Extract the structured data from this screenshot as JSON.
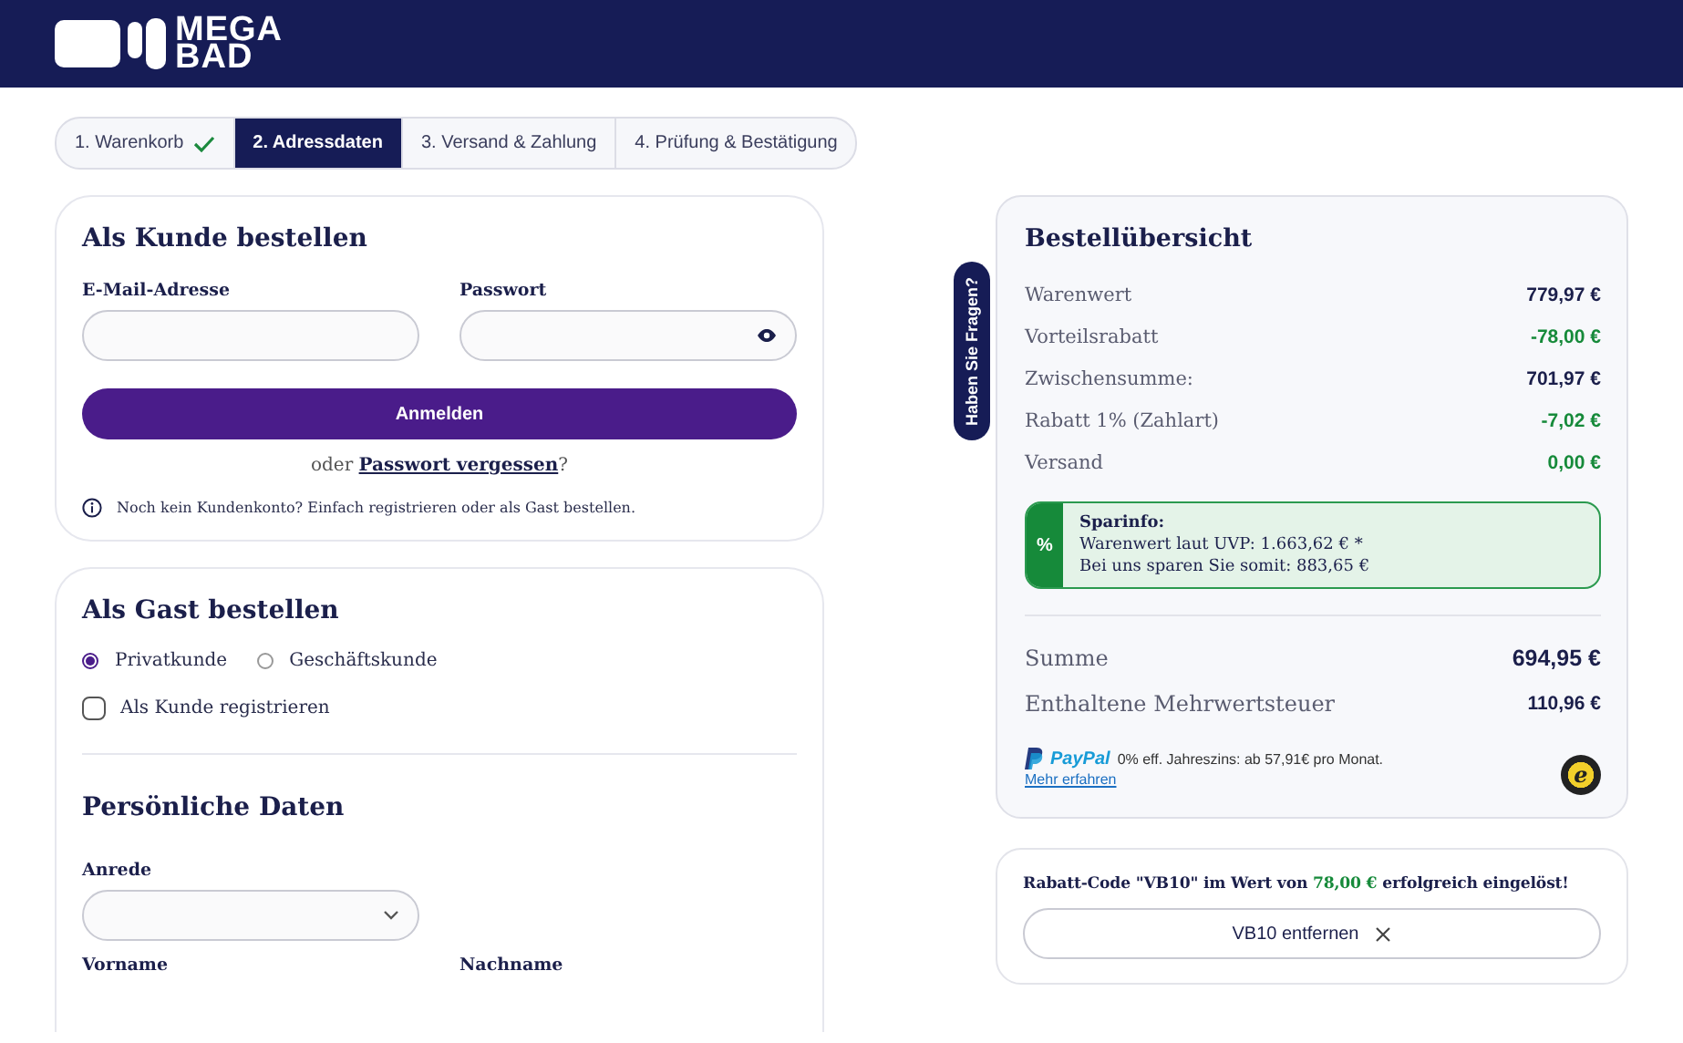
{
  "header": {
    "logo_lines": [
      "MEGA",
      "BAD"
    ]
  },
  "steps": [
    {
      "label": "1. Warenkorb",
      "selected": false,
      "done": true
    },
    {
      "label": "2. Adressdaten",
      "selected": true,
      "done": false
    },
    {
      "label": "3. Versand & Zahlung",
      "selected": false,
      "done": false
    },
    {
      "label": "4. Prüfung & Bestätigung",
      "selected": false,
      "done": false
    }
  ],
  "login": {
    "title": "Als Kunde bestellen",
    "email_label": "E-Mail-Adresse",
    "password_label": "Passwort",
    "submit": "Anmelden",
    "forgot_prefix": "oder",
    "forgot_link": "Passwort vergessen",
    "forgot_suffix": "?",
    "info": "Noch kein Kundenkonto? Einfach registrieren oder als Gast bestellen."
  },
  "guest": {
    "title": "Als Gast bestellen",
    "customer_types": [
      {
        "label": "Privatkunde",
        "selected": true
      },
      {
        "label": "Geschäftskunde",
        "selected": false
      }
    ],
    "register": {
      "label": "Als Kunde registrieren",
      "checked": false
    },
    "personal_title": "Persönliche Daten",
    "salutation_label": "Anrede",
    "first_name_label": "Vorname",
    "last_name_label": "Nachname"
  },
  "help_tab": "Haben Sie Fragen?",
  "summary": {
    "title": "Bestellübersicht",
    "rows": [
      {
        "label": "Warenwert",
        "value": "779,97 €",
        "kind": "normal"
      },
      {
        "label": "Vorteilsrabatt",
        "value": "-78,00 €",
        "kind": "saving"
      },
      {
        "label": "Zwischensumme:",
        "value": "701,97 €",
        "kind": "normal"
      },
      {
        "label": "Rabatt 1% (Zahlart)",
        "value": "-7,02 €",
        "kind": "saving"
      },
      {
        "label": "Versand",
        "value": "0,00 €",
        "kind": "saving"
      }
    ],
    "savings": {
      "badge": "%",
      "title": "Sparinfo:",
      "lines": [
        "Warenwert laut UVP: 1.663,62 € *",
        "Bei uns sparen Sie somit: 883,65 €"
      ]
    },
    "totals": [
      {
        "label": "Summe",
        "value": "694,95 €",
        "kind": "total"
      },
      {
        "label": "Enthaltene Mehrwertsteuer",
        "value": "110,96 €",
        "kind": "normal"
      }
    ],
    "paypal": {
      "brand": "PayPal",
      "text": "0% eff. Jahreszins: ab 57,91€ pro Monat.",
      "link": "Mehr erfahren"
    },
    "trust_badge": "e"
  },
  "voucher": {
    "prefix": "Rabatt-Code \"VB10\" im Wert von ",
    "amount": "78,00 €",
    "suffix": " erfolgreich eingelöst!",
    "remove": "VB10 entfernen"
  }
}
